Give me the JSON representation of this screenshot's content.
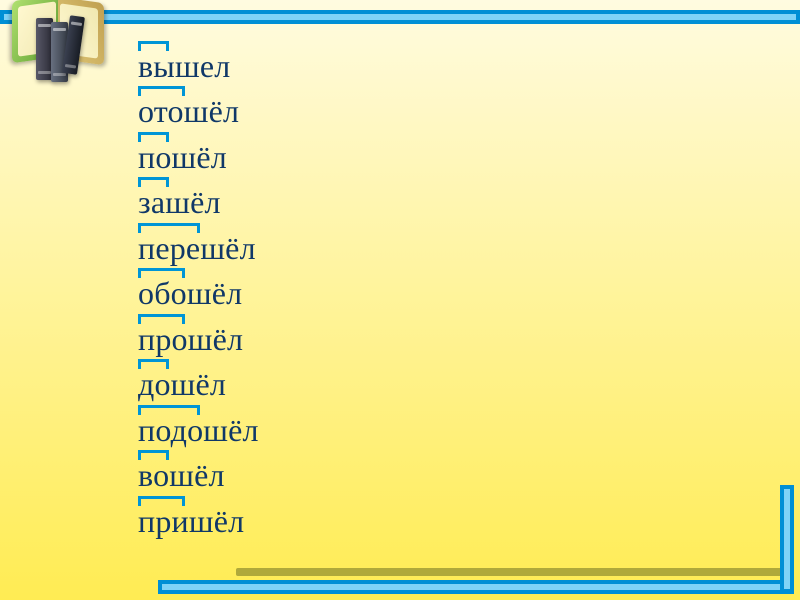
{
  "slide": {
    "words": [
      {
        "text": "вышел",
        "prefix_len": 2
      },
      {
        "text": "отошёл",
        "prefix_len": 3
      },
      {
        "text": "пошёл",
        "prefix_len": 2
      },
      {
        "text": "зашёл",
        "prefix_len": 2
      },
      {
        "text": "перешёл",
        "prefix_len": 4
      },
      {
        "text": "обошёл",
        "prefix_len": 3
      },
      {
        "text": "прошёл",
        "prefix_len": 3
      },
      {
        "text": "дошёл",
        "prefix_len": 2
      },
      {
        "text": "подошёл",
        "prefix_len": 4
      },
      {
        "text": "вошёл",
        "prefix_len": 2
      },
      {
        "text": "пришёл",
        "prefix_len": 3
      }
    ]
  },
  "icon": {
    "name": "books-icon"
  },
  "colors": {
    "bar": "#008fd5",
    "bar_inner": "#7fd3f7",
    "olive": "#b0a93a",
    "text": "#103868"
  }
}
